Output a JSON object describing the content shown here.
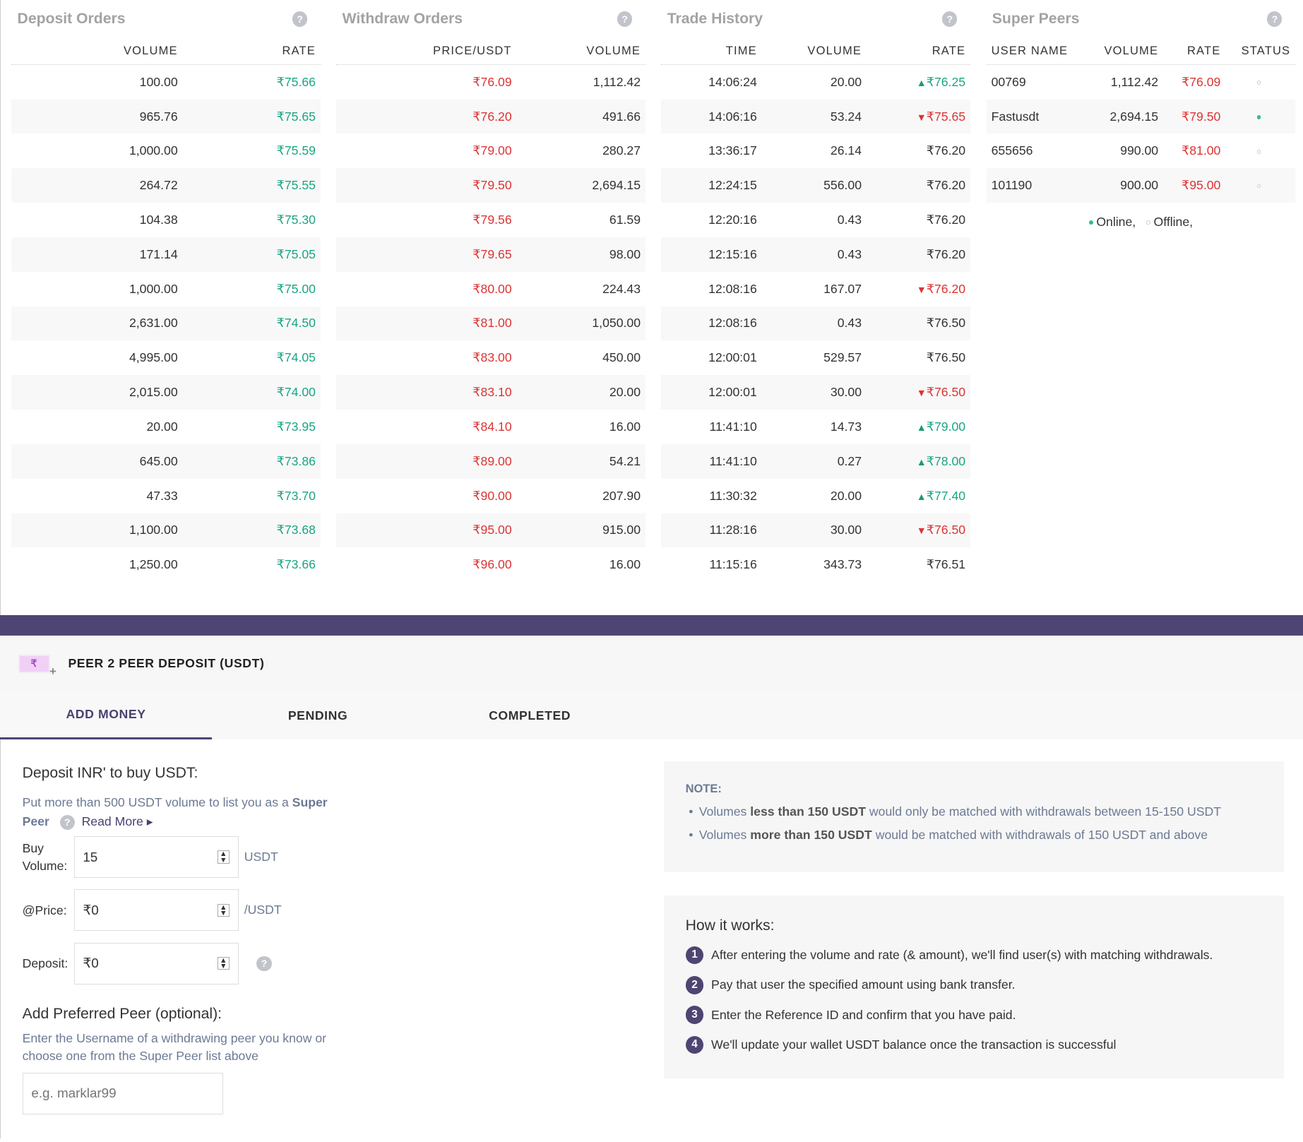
{
  "deposit_orders": {
    "title": "Deposit Orders",
    "headers": [
      "VOLUME",
      "RATE"
    ],
    "rows": [
      [
        "100.00",
        "₹75.66"
      ],
      [
        "965.76",
        "₹75.65"
      ],
      [
        "1,000.00",
        "₹75.59"
      ],
      [
        "264.72",
        "₹75.55"
      ],
      [
        "104.38",
        "₹75.30"
      ],
      [
        "171.14",
        "₹75.05"
      ],
      [
        "1,000.00",
        "₹75.00"
      ],
      [
        "2,631.00",
        "₹74.50"
      ],
      [
        "4,995.00",
        "₹74.05"
      ],
      [
        "2,015.00",
        "₹74.00"
      ],
      [
        "20.00",
        "₹73.95"
      ],
      [
        "645.00",
        "₹73.86"
      ],
      [
        "47.33",
        "₹73.70"
      ],
      [
        "1,100.00",
        "₹73.68"
      ],
      [
        "1,250.00",
        "₹73.66"
      ]
    ]
  },
  "withdraw_orders": {
    "title": "Withdraw Orders",
    "headers": [
      "PRICE/USDT",
      "VOLUME"
    ],
    "rows": [
      [
        "₹76.09",
        "1,112.42"
      ],
      [
        "₹76.20",
        "491.66"
      ],
      [
        "₹79.00",
        "280.27"
      ],
      [
        "₹79.50",
        "2,694.15"
      ],
      [
        "₹79.56",
        "61.59"
      ],
      [
        "₹79.65",
        "98.00"
      ],
      [
        "₹80.00",
        "224.43"
      ],
      [
        "₹81.00",
        "1,050.00"
      ],
      [
        "₹83.00",
        "450.00"
      ],
      [
        "₹83.10",
        "20.00"
      ],
      [
        "₹84.10",
        "16.00"
      ],
      [
        "₹89.00",
        "54.21"
      ],
      [
        "₹90.00",
        "207.90"
      ],
      [
        "₹95.00",
        "915.00"
      ],
      [
        "₹96.00",
        "16.00"
      ]
    ]
  },
  "trade_history": {
    "title": "Trade History",
    "headers": [
      "TIME",
      "VOLUME",
      "RATE"
    ],
    "rows": [
      [
        "14:06:24",
        "20.00",
        "₹76.25",
        "up"
      ],
      [
        "14:06:16",
        "53.24",
        "₹75.65",
        "down"
      ],
      [
        "13:36:17",
        "26.14",
        "₹76.20",
        ""
      ],
      [
        "12:24:15",
        "556.00",
        "₹76.20",
        ""
      ],
      [
        "12:20:16",
        "0.43",
        "₹76.20",
        ""
      ],
      [
        "12:15:16",
        "0.43",
        "₹76.20",
        ""
      ],
      [
        "12:08:16",
        "167.07",
        "₹76.20",
        "down"
      ],
      [
        "12:08:16",
        "0.43",
        "₹76.50",
        ""
      ],
      [
        "12:00:01",
        "529.57",
        "₹76.50",
        ""
      ],
      [
        "12:00:01",
        "30.00",
        "₹76.50",
        "down"
      ],
      [
        "11:41:10",
        "14.73",
        "₹79.00",
        "up"
      ],
      [
        "11:41:10",
        "0.27",
        "₹78.00",
        "up"
      ],
      [
        "11:30:32",
        "20.00",
        "₹77.40",
        "up"
      ],
      [
        "11:28:16",
        "30.00",
        "₹76.50",
        "down"
      ],
      [
        "11:15:16",
        "343.73",
        "₹76.51",
        ""
      ]
    ]
  },
  "super_peers": {
    "title": "Super Peers",
    "headers": [
      "USER NAME",
      "VOLUME",
      "RATE",
      "STATUS"
    ],
    "rows": [
      [
        "00769",
        "1,112.42",
        "₹76.09",
        "offline"
      ],
      [
        "Fastusdt",
        "2,694.15",
        "₹79.50",
        "online"
      ],
      [
        "655656",
        "990.00",
        "₹81.00",
        "offline"
      ],
      [
        "101190",
        "900.00",
        "₹95.00",
        "offline"
      ]
    ],
    "legend_online": "Online,",
    "legend_offline": "Offline,"
  },
  "section": {
    "title": "PEER 2 PEER DEPOSIT (USDT)",
    "icon": "₹"
  },
  "tabs": [
    "ADD MONEY",
    "PENDING",
    "COMPLETED"
  ],
  "form": {
    "heading": "Deposit INR' to buy USDT:",
    "info": "Put more than 500 USDT volume to list you as a ",
    "info_bold1": "Super",
    "info_bold2": "Peer",
    "read_more": "Read More ▸",
    "buy_label": "Buy Volume:",
    "buy_value": "15",
    "buy_unit": "USDT",
    "price_label": "@Price:",
    "price_value": "₹0",
    "price_unit": "/USDT",
    "deposit_label": "Deposit:",
    "deposit_value": "₹0",
    "peer_heading": "Add Preferred Peer (optional):",
    "peer_help": "Enter the Username of a withdrawing peer you know or choose one from the Super Peer list above",
    "peer_placeholder": "e.g. marklar99"
  },
  "note": {
    "title": "NOTE:",
    "items": [
      {
        "pre": "Volumes ",
        "bold": "less than 150 USDT",
        "post": " would only be matched with withdrawals between 15-150 USDT"
      },
      {
        "pre": "Volumes ",
        "bold": "more than 150 USDT",
        "post": " would be matched with withdrawals of 150 USDT and above"
      }
    ]
  },
  "how": {
    "title": "How it works:",
    "steps": [
      "After entering the volume and rate (& amount), we'll find user(s) with matching withdrawals.",
      "Pay that user the specified amount using bank transfer.",
      "Enter the Reference ID and confirm that you have paid.",
      "We'll update your wallet USDT balance once the transaction is successful"
    ]
  },
  "colors": {
    "accent": "#4e4572",
    "green": "#1aa584",
    "red": "#dd3333"
  }
}
